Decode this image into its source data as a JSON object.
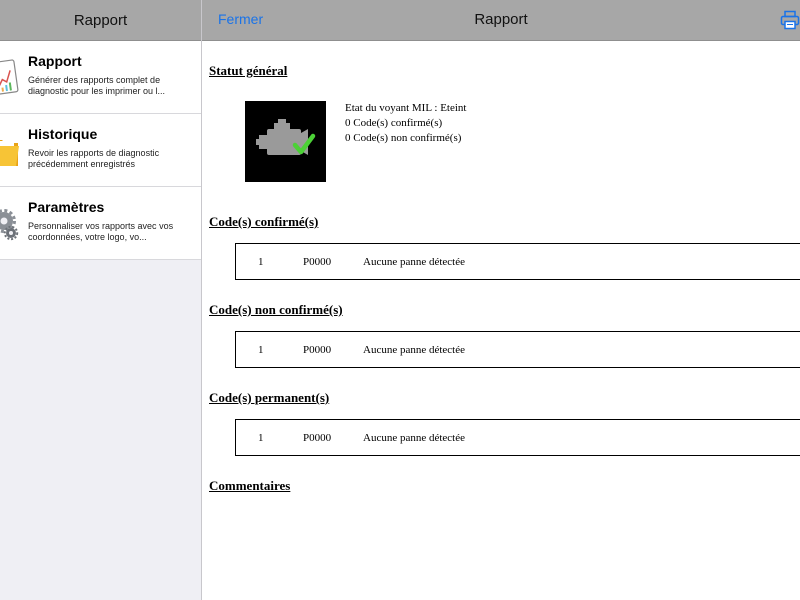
{
  "sidebar": {
    "title": "Rapport",
    "items": [
      {
        "title": "Rapport",
        "description": "Générer des rapports complet de diagnostic pour les imprimer ou l..."
      },
      {
        "title": "Historique",
        "description": "Revoir les rapports de diagnostic précédemment enregistrés"
      },
      {
        "title": "Paramètres",
        "description": "Personnaliser vos rapports avec vos coordonnées, votre logo, vo..."
      }
    ]
  },
  "header": {
    "close_label": "Fermer",
    "title": "Rapport"
  },
  "report": {
    "general_status": {
      "title": "Statut général",
      "lines": [
        "Etat du voyant MIL : Eteint",
        "0 Code(s) confirmé(s)",
        "0 Code(s) non confirmé(s)"
      ]
    },
    "confirmed": {
      "title": "Code(s) confirmé(s)",
      "row": {
        "index": "1",
        "code": "P0000",
        "description": "Aucune panne détectée"
      }
    },
    "unconfirmed": {
      "title": "Code(s) non confirmé(s)",
      "row": {
        "index": "1",
        "code": "P0000",
        "description": "Aucune panne détectée"
      }
    },
    "permanent": {
      "title": "Code(s) permanent(s)",
      "row": {
        "index": "1",
        "code": "P0000",
        "description": "Aucune panne détectée"
      }
    },
    "comments_title": "Commentaires"
  },
  "colors": {
    "nav_bar": "#a7a7a7",
    "accent": "#1a73e8",
    "engine_icon": "#9a9a9a",
    "check": "#4cd137"
  },
  "icons": {
    "rapport": "report-chart-icon",
    "historique": "folder-icon",
    "parametres": "gears-icon",
    "print": "printer-icon",
    "engine": "engine-check-icon"
  }
}
